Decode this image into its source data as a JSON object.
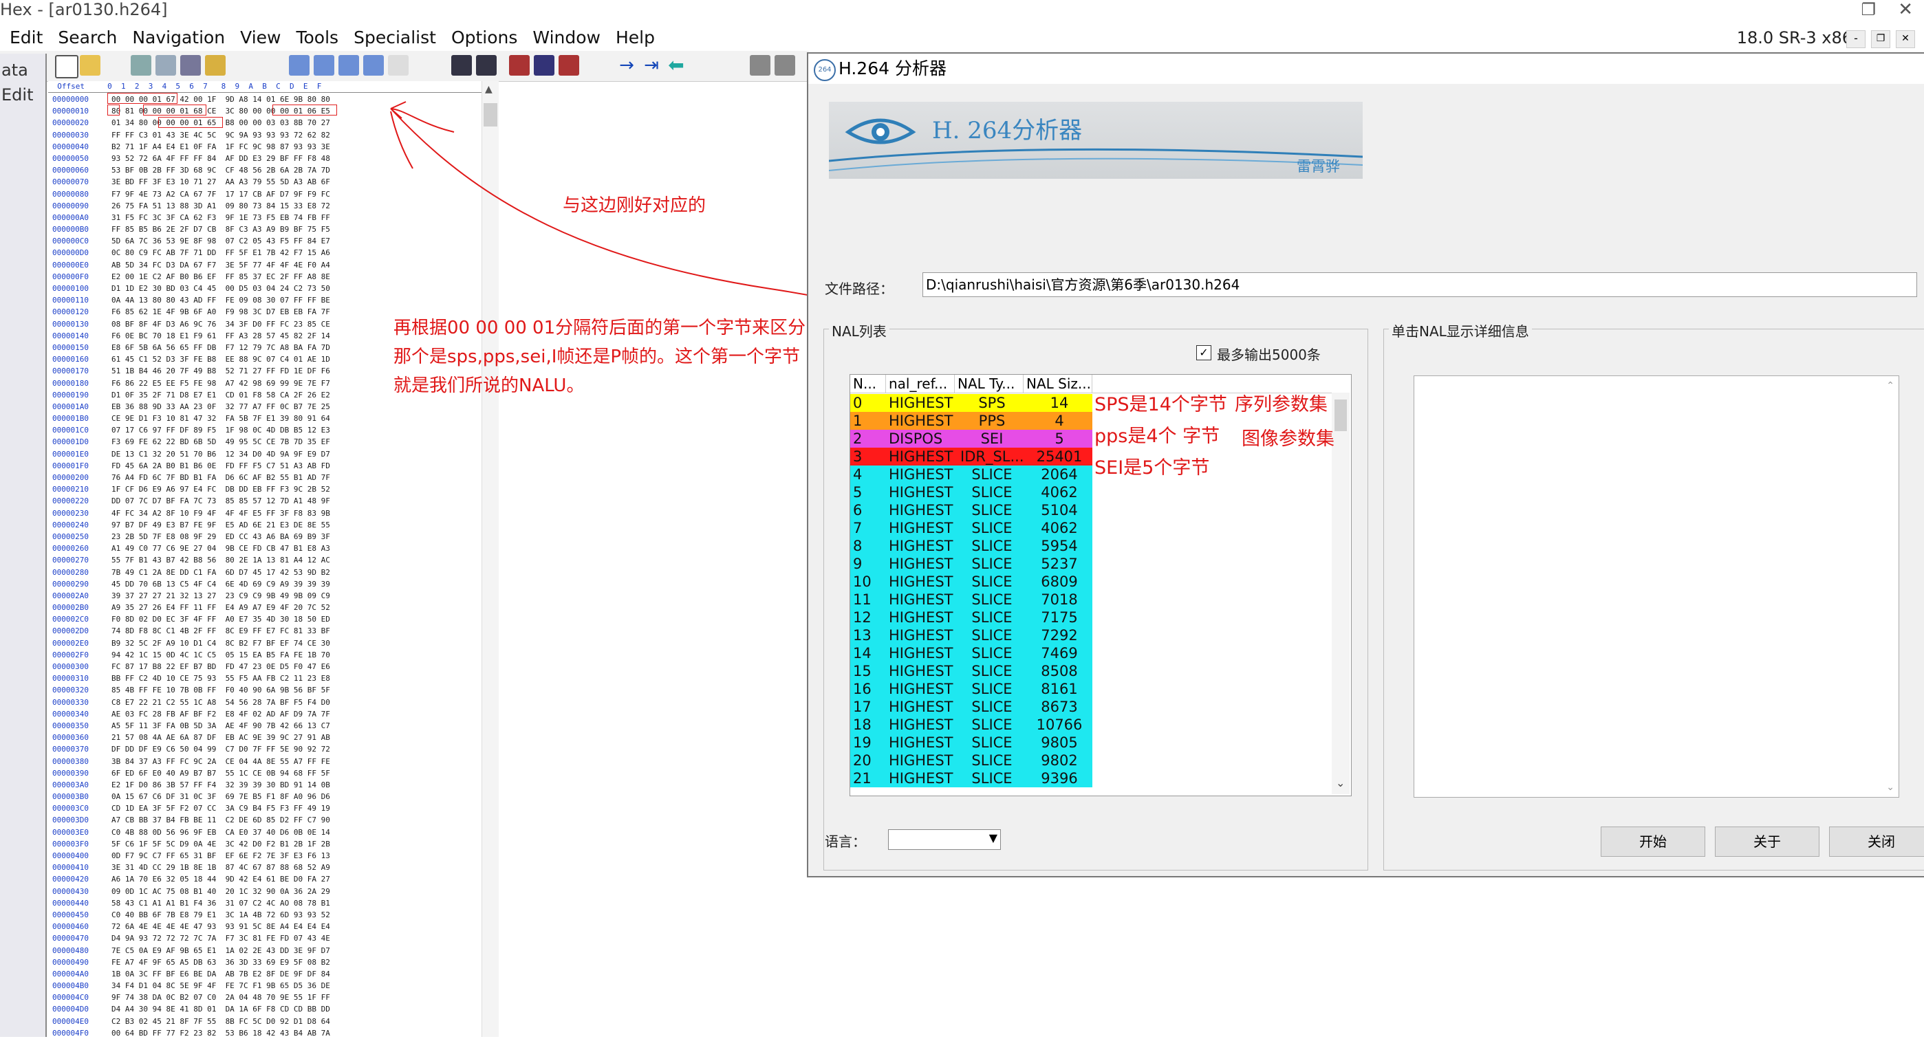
{
  "hex_editor": {
    "title": "Hex - [ar0130.h264]",
    "menu": [
      "Edit",
      "Search",
      "Navigation",
      "View",
      "Tools",
      "Specialist",
      "Options",
      "Window",
      "Help"
    ],
    "version": "18.0 SR-3 x86",
    "side_tabs": [
      "ata",
      "Edit"
    ],
    "column_header": "  Offset     0  1  2  3  4  5  6  7   8  9  A  B  C  D  E  F",
    "rows": [
      [
        "00000000",
        "00 00 00 01 67 42 00 1F  9D A8 14 01 6E 9B 80 80"
      ],
      [
        "00000010",
        "80 81 00 00 00 01 68 CE  3C 80 00 00 00 01 06 E5"
      ],
      [
        "00000020",
        "01 34 80 00 00 00 01 65  B8 00 00 03 03 8B 70 27"
      ],
      [
        "00000030",
        "FF FF C3 01 43 3E 4C 5C  9C 9A 93 93 93 72 62 82"
      ],
      [
        "00000040",
        "B2 71 1F A4 E4 E1 0F FA  1F FC 9C 98 87 93 93 3E"
      ],
      [
        "00000050",
        "93 52 72 6A 4F FF FF 84  AF DD E3 29 BF FF F8 48"
      ],
      [
        "00000060",
        "53 BF 0B 2B FF 3D 68 9C  CF 48 56 2B 6A 2B 7A 7D"
      ],
      [
        "00000070",
        "3E BD FF 3F E3 10 71 27  AA A3 79 55 5D A3 AB 6F"
      ],
      [
        "00000080",
        "F7 9F 4E 73 A2 CA 67 7F  17 17 CB AF D7 9F F9 FC"
      ],
      [
        "00000090",
        "26 75 FA 51 13 88 3D A1  09 80 73 84 15 33 E8 72"
      ],
      [
        "000000A0",
        "31 F5 FC 3C 3F CA 62 F3  9F 1E 73 F5 EB 74 FB FF"
      ],
      [
        "000000B0",
        "FF 85 B5 B6 2E 2F D7 CB  8F C3 A3 A9 B9 BF 75 F5"
      ],
      [
        "000000C0",
        "5D 6A 7C 36 53 9E 8F 98  07 C2 05 43 F5 FF 84 E7"
      ],
      [
        "000000D0",
        "0C 80 C9 FC AB 7F 71 DD  FF 5F E1 7B 42 F7 15 A6"
      ],
      [
        "000000E0",
        "AB 5D 34 FC D3 DA 67 F7  3E 5F 77 4F 4F 4E F0 A4"
      ],
      [
        "000000F0",
        "E2 00 1E C2 AF B0 B6 EF  FF 85 37 EC 2F FF A8 8E"
      ],
      [
        "00000100",
        "D1 1D E2 30 BD 03 C4 45  00 D5 03 04 24 C2 73 50"
      ],
      [
        "00000110",
        "0A 4A 13 80 80 43 AD FF  FE 09 08 30 07 FF FF BE"
      ],
      [
        "00000120",
        "F6 85 62 1E 4F 9B 6F A0  F9 98 3C D7 EB EB FA 7F"
      ],
      [
        "00000130",
        "08 BF 8F 4F D3 A6 9C 76  34 3F D0 FF FC 23 85 CE"
      ],
      [
        "00000140",
        "F6 0E BC 70 18 E1 F9 61  FF A3 28 57 45 82 2F 14"
      ],
      [
        "00000150",
        "E8 6F 5B 6A 56 65 FF DB  F7 12 79 7C A8 BA FA 7D"
      ],
      [
        "00000160",
        "61 45 C1 52 D3 3F FE B8  EE 88 9C 07 C4 01 AE 1D"
      ],
      [
        "00000170",
        "51 1B B4 46 20 7F 49 B8  52 71 27 FF FD 1E DF F6"
      ],
      [
        "00000180",
        "F6 86 22 E5 EE F5 FE 98  A7 42 98 69 99 9E 7E F7"
      ],
      [
        "00000190",
        "D1 0F 35 2F 71 D8 E7 E1  CD 01 F8 58 CA 2F 26 E2"
      ],
      [
        "000001A0",
        "EB 36 88 9D 33 AA 23 0F  32 77 A7 FF 0C B7 7E 25"
      ],
      [
        "000001B0",
        "CE 9E D1 F3 10 81 47 32  FA 5B 7F E1 39 80 91 64"
      ],
      [
        "000001C0",
        "07 17 C6 97 FF DF 89 F5  1F 98 0C 4D DB B5 12 E3"
      ],
      [
        "000001D0",
        "F3 69 FE 62 22 BD 6B 5D  49 95 5C CE 7B 7D 35 EF"
      ],
      [
        "000001E0",
        "DE 13 C1 32 20 51 70 B6  12 34 D0 4D 9A 9F E9 D7"
      ],
      [
        "000001F0",
        "FD 45 6A 2A B0 B1 B6 0E  FD FF F5 C7 51 A3 AB FD"
      ],
      [
        "00000200",
        "76 A4 FD 6C 7F BD B1 FA  D6 6C AF B2 55 B1 AD 7F"
      ],
      [
        "00000210",
        "1F CF D6 E9 A6 97 E4 FC  DB DD EB FF F3 9C 2B 52"
      ],
      [
        "00000220",
        "DD 07 7C D7 BF FA 7C 73  85 85 57 12 7D A1 48 9F"
      ],
      [
        "00000230",
        "4F FC 34 A2 8F 10 F9 4F  4F 4F E5 FF 3F F8 83 9B"
      ],
      [
        "00000240",
        "97 B7 DF 49 E3 B7 FE 9F  E5 AD 6E 21 E3 DE 8E 55"
      ],
      [
        "00000250",
        "23 2B 5D 7F E8 08 9F 29  ED CC 43 A6 BA 69 B9 3F"
      ],
      [
        "00000260",
        "A1 49 C0 77 C6 9E 27 04  9B CE FD CB 47 B1 E8 A3"
      ],
      [
        "00000270",
        "55 7F B1 43 B7 42 B8 56  80 2E 1A 13 81 A4 12 AC"
      ],
      [
        "00000280",
        "7B 49 C1 2A 8E DD C1 FA  6D D7 45 17 42 53 9D B2"
      ],
      [
        "00000290",
        "45 DD 70 6B 13 C5 4F C4  6E 4D 69 C9 A9 39 39 39"
      ],
      [
        "000002A0",
        "39 37 27 27 21 32 13 27  23 C9 C9 9B 49 9B 09 C9"
      ],
      [
        "000002B0",
        "A9 35 27 26 E4 FF 11 FF  E4 A9 A7 E9 4F 20 7C 52"
      ],
      [
        "000002C0",
        "F0 8D 02 D0 EC 3F 4F FF  A0 E7 35 4D 30 18 50 ED"
      ],
      [
        "000002D0",
        "74 8D F8 8C C1 4B 2F FF  8C E9 FF E7 FC 81 33 BF"
      ],
      [
        "000002E0",
        "B9 32 5C 2F A9 10 D1 C4  8C B2 F7 BF EF 74 CE 30"
      ],
      [
        "000002F0",
        "94 42 1C 15 0D 4C 1C C5  05 15 EA B5 FA FE 1B 70"
      ],
      [
        "00000300",
        "FC 87 17 B8 22 EF B7 BD  FD 47 23 0E D5 F0 47 E6"
      ],
      [
        "00000310",
        "BB FF C2 4D 10 CE 75 93  55 F5 AA FB C2 11 23 E8"
      ],
      [
        "00000320",
        "85 4B FF FE 10 7B 0B FF  F0 40 90 6A 9B 56 BF 5F"
      ],
      [
        "00000330",
        "C8 E7 22 21 C2 55 1C A8  54 56 28 7A BF F5 F4 D0"
      ],
      [
        "00000340",
        "AE 03 FC 28 FB AF BF F2  E8 4F 02 AD AF D9 7A 7F"
      ],
      [
        "00000350",
        "A5 5F 11 3F FA 0B 5D 3A  AE 4F 90 7B 42 66 13 C7"
      ],
      [
        "00000360",
        "21 57 08 4A AE 6A 87 DF  EB AC 9E 39 9C 27 91 AB"
      ],
      [
        "00000370",
        "DF DD DF E9 C6 50 04 99  C7 D0 7F FF 5E 90 92 72"
      ],
      [
        "00000380",
        "3B 84 37 A3 FF FC 9C 2A  CE 04 4A 8E 55 A7 FF FE"
      ],
      [
        "00000390",
        "6F ED 6F E0 40 A9 B7 B7  55 1C CE 0B 94 68 FF 5F"
      ],
      [
        "000003A0",
        "E2 1F D0 86 3B 57 FF F4  32 39 39 30 BD 91 14 0B"
      ],
      [
        "000003B0",
        "0A 15 67 C6 DF 31 0C 3F  69 7E B5 F1 8F A0 96 D6"
      ],
      [
        "000003C0",
        "CD 1D EA 3F 5F F2 07 CC  3A C9 B4 F5 F3 FF 49 19"
      ],
      [
        "000003D0",
        "A7 CB BB 37 B4 FB BE 11  C2 DE 6D 85 D2 FF C7 90"
      ],
      [
        "000003E0",
        "C0 4B 88 0D 56 96 9F EB  CA E0 37 40 D6 0B 0E 14"
      ],
      [
        "000003F0",
        "5F C6 1F 5F 5C D9 0A 4E  3C 42 D0 F2 B1 2B 1F 2B"
      ],
      [
        "00000400",
        "0D F7 9C C7 FF 65 31 BF  EF 6E F2 7E 3F E3 F6 13"
      ],
      [
        "00000410",
        "3E 31 4D CC 29 1B 8E 1B  87 4C 67 87 88 68 52 A9"
      ],
      [
        "00000420",
        "A6 1A 70 E6 32 05 18 44  9D 42 E4 61 BE D0 FA 27"
      ],
      [
        "00000430",
        "09 0D 1C AC 75 08 B1 40  20 1C 32 90 0A 36 2A 29"
      ],
      [
        "00000440",
        "58 43 C1 A1 A1 B1 F4 36  31 07 C2 4C AO 08 78 B1"
      ],
      [
        "00000450",
        "C0 40 BB 6F 7B E8 79 E1  3C 1A 4B 72 6D 93 93 52"
      ],
      [
        "00000460",
        "72 6A 4E 4E 4E 4E 47 93  93 91 5C 8E A4 E4 E4 E4"
      ],
      [
        "00000470",
        "D4 9A 93 72 72 72 7C 7A  F7 3C 81 FE FD 07 43 4E"
      ],
      [
        "00000480",
        "7E C5 0A E9 AF 9B 65 E1  1A 02 2E 43 DD 3E 9F D7"
      ],
      [
        "00000490",
        "FE A7 4F 9F 65 A5 DB 63  36 3D 33 69 E9 5F 08 B2"
      ],
      [
        "000004A0",
        "1B 0A 3C FF BF E6 BE DA  AB 7B E2 8F DE 9F DF 84"
      ],
      [
        "000004B0",
        "34 F4 D1 04 8C 5E 9F 4F  FE 7C F1 9B 65 D5 36 DE"
      ],
      [
        "000004C0",
        "9F 74 38 DA 0C B2 07 C0  2A 04 48 70 9E 55 1F FF"
      ],
      [
        "000004D0",
        "D4 A4 30 94 8E 41 8D 01  DA 1A 6F F8 CD CD BB DD"
      ],
      [
        "000004E0",
        "C2 B3 02 45 21 8F 7F 55  8B FC 5C D0 92 D1 D8 64"
      ],
      [
        "000004F0",
        "00 64 BD FF 77 F2 23 82  53 B6 18 42 43 B4 AB 7A"
      ]
    ],
    "annotations": {
      "match_note": "与这边刚好对应的",
      "explain_line1": "再根据00 00 00 01分隔符后面的第一个字节来区分",
      "explain_line2": "那个是sps,pps,sei,I帧还是P帧的。这个第一个字节",
      "explain_line3": "就是我们所说的NALU。"
    }
  },
  "analyzer": {
    "title": "H.264 分析器",
    "banner_title": "H. 264分析器",
    "banner_author": "雷霄骅",
    "path_label": "文件路径：",
    "path_value": "D:\\qianrushi\\haisi\\官方资源\\第6季\\ar0130.h264",
    "nal_list_label": "NAL列表",
    "max_output_label": "最多输出5000条",
    "max_output_checked": true,
    "detail_label": "单击NAL显示详细信息",
    "columns": [
      "N...",
      "nal_ref...",
      "NAL Ty...",
      "NAL Siz..."
    ],
    "rows": [
      {
        "n": "0",
        "ref": "HIGHEST",
        "type": "SPS",
        "size": "14",
        "color": "#ffff00"
      },
      {
        "n": "1",
        "ref": "HIGHEST",
        "type": "PPS",
        "size": "4",
        "color": "#ff9a1a"
      },
      {
        "n": "2",
        "ref": "DISPOS",
        "type": "SEI",
        "size": "5",
        "color": "#e64de6"
      },
      {
        "n": "3",
        "ref": "HIGHEST",
        "type": "IDR_SL...",
        "size": "25401",
        "color": "#ff1a1a"
      },
      {
        "n": "4",
        "ref": "HIGHEST",
        "type": "SLICE",
        "size": "2064",
        "color": "#1ee8f0"
      },
      {
        "n": "5",
        "ref": "HIGHEST",
        "type": "SLICE",
        "size": "4062",
        "color": "#1ee8f0"
      },
      {
        "n": "6",
        "ref": "HIGHEST",
        "type": "SLICE",
        "size": "5104",
        "color": "#1ee8f0"
      },
      {
        "n": "7",
        "ref": "HIGHEST",
        "type": "SLICE",
        "size": "4062",
        "color": "#1ee8f0"
      },
      {
        "n": "8",
        "ref": "HIGHEST",
        "type": "SLICE",
        "size": "5954",
        "color": "#1ee8f0"
      },
      {
        "n": "9",
        "ref": "HIGHEST",
        "type": "SLICE",
        "size": "5237",
        "color": "#1ee8f0"
      },
      {
        "n": "10",
        "ref": "HIGHEST",
        "type": "SLICE",
        "size": "6809",
        "color": "#1ee8f0"
      },
      {
        "n": "11",
        "ref": "HIGHEST",
        "type": "SLICE",
        "size": "7018",
        "color": "#1ee8f0"
      },
      {
        "n": "12",
        "ref": "HIGHEST",
        "type": "SLICE",
        "size": "7175",
        "color": "#1ee8f0"
      },
      {
        "n": "13",
        "ref": "HIGHEST",
        "type": "SLICE",
        "size": "7292",
        "color": "#1ee8f0"
      },
      {
        "n": "14",
        "ref": "HIGHEST",
        "type": "SLICE",
        "size": "7469",
        "color": "#1ee8f0"
      },
      {
        "n": "15",
        "ref": "HIGHEST",
        "type": "SLICE",
        "size": "8508",
        "color": "#1ee8f0"
      },
      {
        "n": "16",
        "ref": "HIGHEST",
        "type": "SLICE",
        "size": "8161",
        "color": "#1ee8f0"
      },
      {
        "n": "17",
        "ref": "HIGHEST",
        "type": "SLICE",
        "size": "8673",
        "color": "#1ee8f0"
      },
      {
        "n": "18",
        "ref": "HIGHEST",
        "type": "SLICE",
        "size": "10766",
        "color": "#1ee8f0"
      },
      {
        "n": "19",
        "ref": "HIGHEST",
        "type": "SLICE",
        "size": "9805",
        "color": "#1ee8f0"
      },
      {
        "n": "20",
        "ref": "HIGHEST",
        "type": "SLICE",
        "size": "9802",
        "color": "#1ee8f0"
      },
      {
        "n": "21",
        "ref": "HIGHEST",
        "type": "SLICE",
        "size": "9396",
        "color": "#1ee8f0"
      }
    ],
    "side_notes": {
      "sps": "SPS是14个字节",
      "sps_desc": "序列参数集",
      "pps": "pps是4个 字节",
      "pps_desc": "图像参数集",
      "sei": "SEI是5个字节"
    },
    "language_label": "语言：",
    "buttons": {
      "start": "开始",
      "about": "关于",
      "close": "关闭"
    }
  },
  "colors": {
    "annotation_red": "#e01818",
    "hex_offset_blue": "#1a3ec8",
    "banner_blue": "#3a86c0"
  }
}
